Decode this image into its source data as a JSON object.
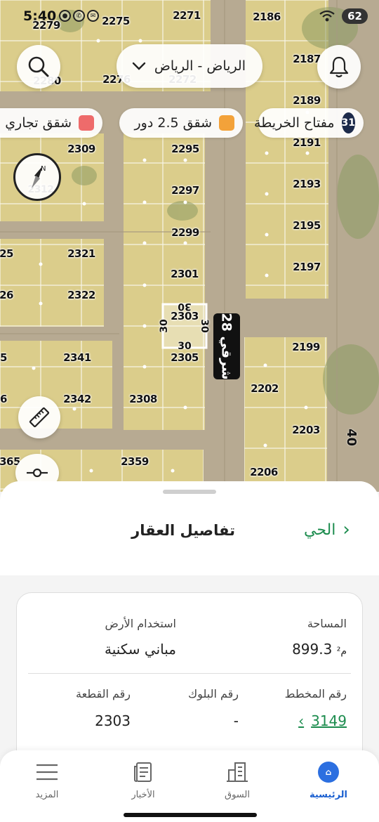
{
  "status_bar": {
    "time": "5:40",
    "battery": "62"
  },
  "map": {
    "city_select": "الرياض - الرياض",
    "legend": {
      "commercial": {
        "label": "شقق تجاري",
        "color": "#ee6b6b"
      },
      "apartments_25": {
        "label": "شقق 2.5 دور",
        "color": "#f3a23a"
      },
      "key": {
        "label": "مفتاح الخريطة",
        "count": "31"
      }
    },
    "parcels": [
      {
        "n": "2279"
      },
      {
        "n": "2275"
      },
      {
        "n": "2271"
      },
      {
        "n": "2186"
      },
      {
        "n": "2187"
      },
      {
        "n": "2280"
      },
      {
        "n": "2276"
      },
      {
        "n": "2272"
      },
      {
        "n": "2189"
      },
      {
        "n": "2309"
      },
      {
        "n": "2295"
      },
      {
        "n": "2191"
      },
      {
        "n": "2312"
      },
      {
        "n": "2297"
      },
      {
        "n": "2193"
      },
      {
        "n": "2299"
      },
      {
        "n": "2195"
      },
      {
        "n": "25"
      },
      {
        "n": "2321"
      },
      {
        "n": "2197"
      },
      {
        "n": "2301"
      },
      {
        "n": "26"
      },
      {
        "n": "2322"
      },
      {
        "n": "2303"
      },
      {
        "n": "5"
      },
      {
        "n": "2341"
      },
      {
        "n": "2305"
      },
      {
        "n": "2199"
      },
      {
        "n": "2202"
      },
      {
        "n": "6"
      },
      {
        "n": "2342"
      },
      {
        "n": "2308"
      },
      {
        "n": "2203"
      },
      {
        "n": "365"
      },
      {
        "n": "2359"
      },
      {
        "n": "2206"
      }
    ],
    "dimensions": {
      "top": "30",
      "left": "30",
      "right": "30",
      "bottom": "30"
    },
    "street": "28 شرقي",
    "road": "40"
  },
  "sheet": {
    "title": "تفاصيل العقار",
    "back_label": "الحي",
    "area_label": "المساحة",
    "area_value": "899.3",
    "area_unit": "م²",
    "land_use_label": "استخدام الأرض",
    "land_use_value": "مباني سكنية",
    "plan_label": "رقم المخطط",
    "plan_value": "3149",
    "block_label": "رقم البلوك",
    "block_value": "-",
    "plot_label": "رقم القطعة",
    "plot_value": "2303"
  },
  "tabs": [
    {
      "label": "الرئيسية",
      "icon": "home-icon"
    },
    {
      "label": "السوق",
      "icon": "building-icon"
    },
    {
      "label": "الأخبار",
      "icon": "news-icon"
    },
    {
      "label": "المزيد",
      "icon": "menu-icon"
    }
  ]
}
